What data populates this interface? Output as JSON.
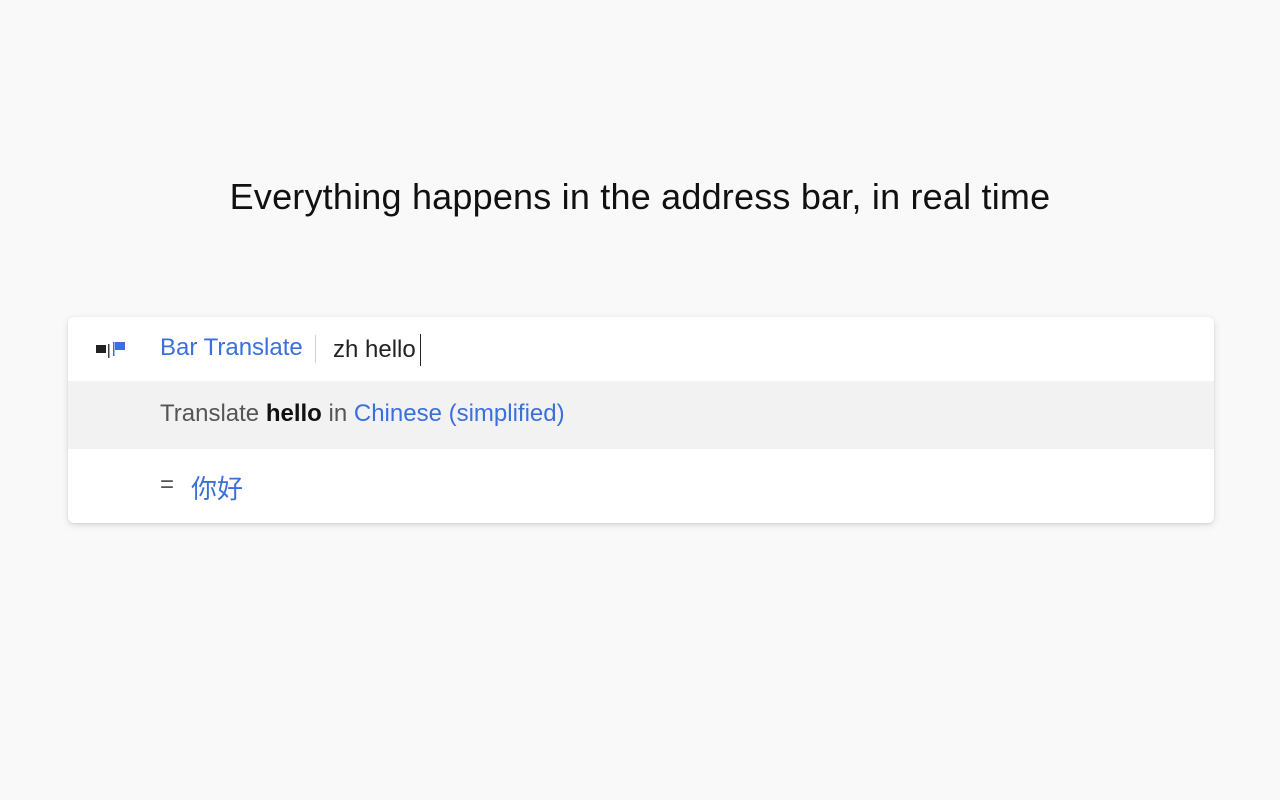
{
  "headline": "Everything happens in the address bar, in real time",
  "omnibox": {
    "keyword": "Bar Translate",
    "query": "zh hello",
    "icon": "flag-icon"
  },
  "suggestion": {
    "prefix": "Translate",
    "word": "hello",
    "middle": "in",
    "language": "Chinese (simplified)"
  },
  "result": {
    "equals": "=",
    "translation": "你好"
  },
  "colors": {
    "accent": "#3b6fdc",
    "background": "#f9f9f9",
    "suggestion_bg": "#f2f2f2"
  }
}
